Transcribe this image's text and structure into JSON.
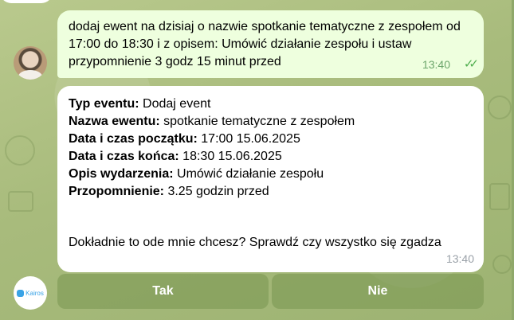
{
  "messages": {
    "outgoing": {
      "text": "dodaj ewent na dzisiaj o nazwie spotkanie tematyczne z zespołem od 17:00 do 18:30 i z opisem: Umówić działanie zespołu i ustaw przypomnienie 3 godz 15 minut przed",
      "time": "13:40",
      "status_icon": "double-check-icon"
    },
    "incoming": {
      "fields": [
        {
          "label": "Typ eventu:",
          "value": " Dodaj event"
        },
        {
          "label": "Nazwa ewentu:",
          "value": " spotkanie tematyczne z zespołem"
        },
        {
          "label": "Data i czas początku:",
          "value": " 17:00 15.06.2025"
        },
        {
          "label": "Data i czas końca:",
          "value": " 18:30 15.06.2025"
        },
        {
          "label": "Opis wydarzenia:",
          "value": " Umówić działanie zespołu"
        },
        {
          "label": "Przopomnienie:",
          "value": " 3.25 godzin przed"
        }
      ],
      "footer": "Dokładnie to ode mnie chcesz? Sprawdź czy wszystko się zgadza",
      "time": "13:40"
    }
  },
  "keyboard": {
    "yes_label": "Tak",
    "no_label": "Nie"
  },
  "bot": {
    "name": "Kairos"
  }
}
